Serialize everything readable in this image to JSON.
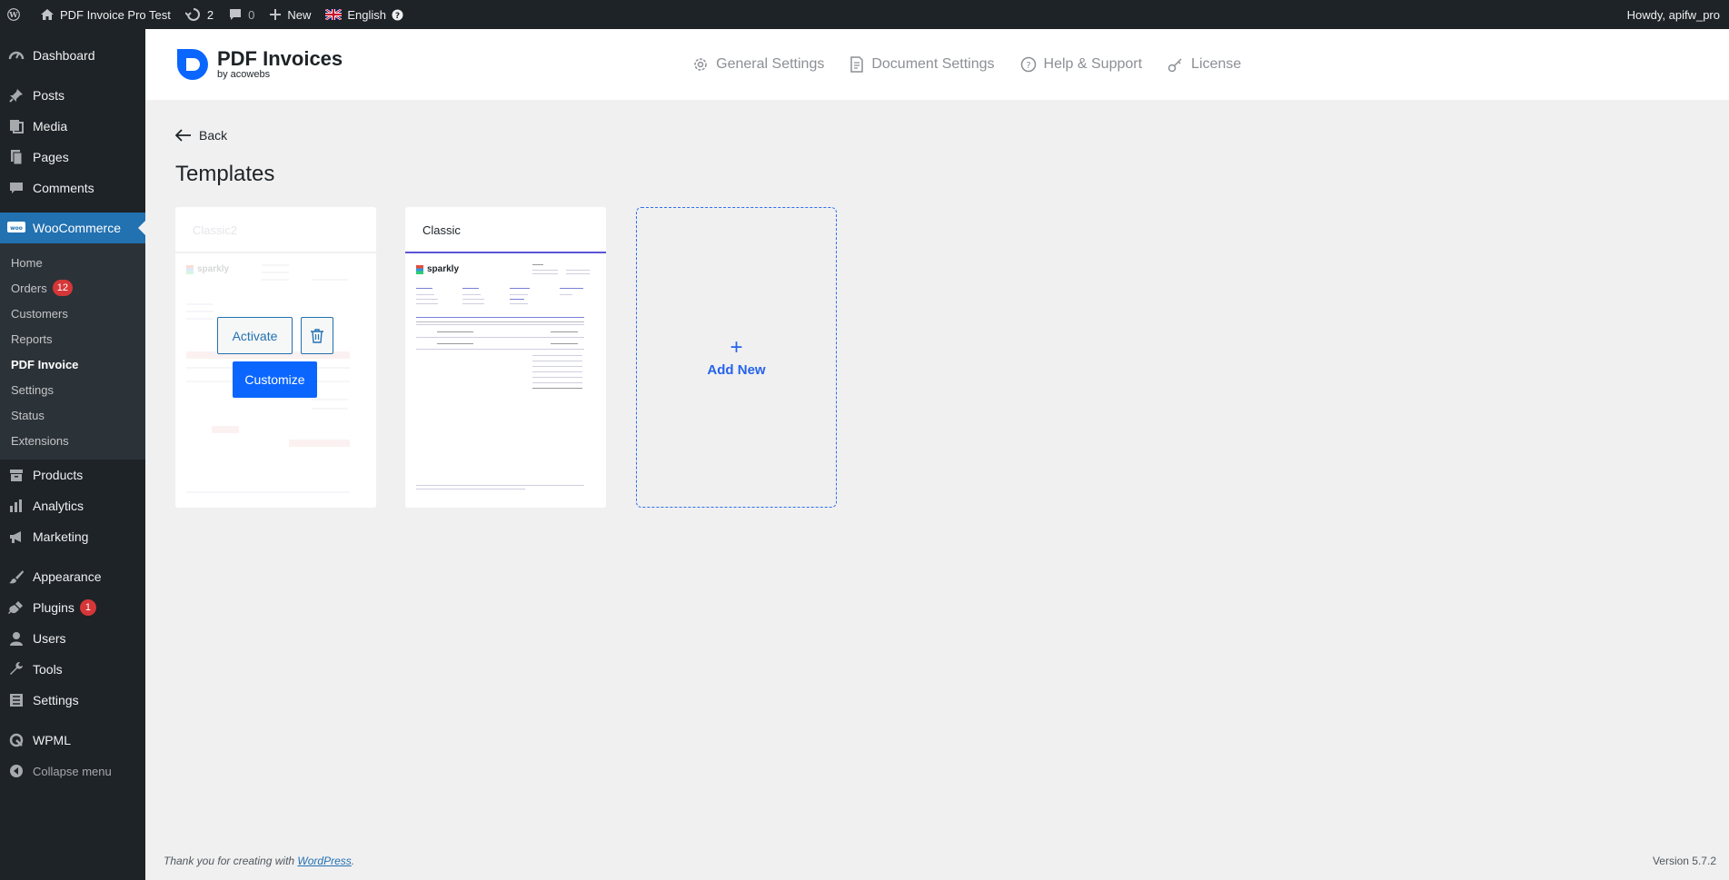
{
  "admin_bar": {
    "site_name": "PDF Invoice Pro Test",
    "updates_count": "2",
    "comments_count": "0",
    "new_label": "New",
    "language": "English",
    "howdy": "Howdy, apifw_pro"
  },
  "sidebar": {
    "items_top": [
      {
        "label": "Dashboard",
        "icon": "dashboard-icon"
      },
      {
        "label": "Posts",
        "icon": "pin-icon"
      },
      {
        "label": "Media",
        "icon": "media-icon"
      },
      {
        "label": "Pages",
        "icon": "pages-icon"
      },
      {
        "label": "Comments",
        "icon": "comment-icon"
      }
    ],
    "woocommerce": "WooCommerce",
    "woo_sub": [
      "Home",
      "Orders",
      "Customers",
      "Reports",
      "PDF Invoice",
      "Settings",
      "Status",
      "Extensions"
    ],
    "orders_badge": "12",
    "items_mid": [
      {
        "label": "Products",
        "icon": "archive-icon"
      },
      {
        "label": "Analytics",
        "icon": "bar-chart-icon"
      },
      {
        "label": "Marketing",
        "icon": "megaphone-icon"
      }
    ],
    "items_bottom": [
      {
        "label": "Appearance",
        "icon": "brush-icon"
      },
      {
        "label": "Plugins",
        "icon": "plugin-icon"
      },
      {
        "label": "Users",
        "icon": "user-icon"
      },
      {
        "label": "Tools",
        "icon": "wrench-icon"
      },
      {
        "label": "Settings",
        "icon": "settings-icon"
      }
    ],
    "plugins_badge": "1",
    "wpml": "WPML",
    "collapse": "Collapse menu"
  },
  "plugin_header": {
    "brand_title": "PDF Invoices",
    "brand_sub": "by acowebs",
    "nav": [
      "General Settings",
      "Document Settings",
      "Help & Support",
      "License"
    ]
  },
  "content": {
    "back": "Back",
    "title": "Templates",
    "templates": [
      {
        "name": "Classic2",
        "activate": "Activate",
        "customize": "Customize"
      },
      {
        "name": "Classic"
      }
    ],
    "preview_brand": "sparkly",
    "add_new": "Add New",
    "add_plus": "+"
  },
  "footer": {
    "thanks": "Thank you for creating with ",
    "wp_link": "WordPress",
    "version": "Version 5.7.2"
  },
  "colors": {
    "accent": "#2271b1",
    "primary_btn": "#0a66ff",
    "badge": "#d63638"
  }
}
